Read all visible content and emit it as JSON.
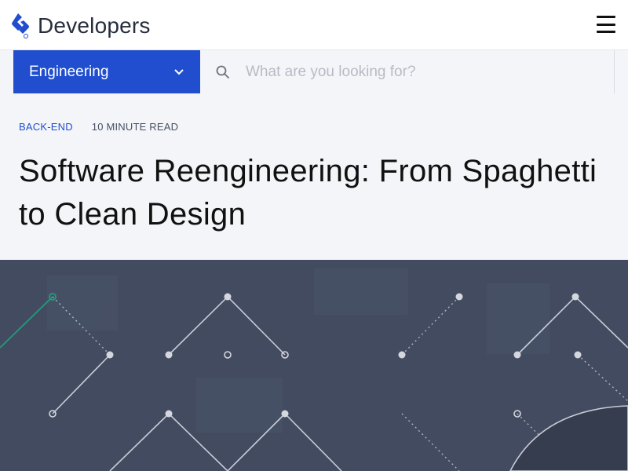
{
  "header": {
    "brand": "Developers",
    "menu_icon": "hamburger-menu-icon"
  },
  "search": {
    "category": "Engineering",
    "placeholder": "What are you looking for?",
    "value": ""
  },
  "article": {
    "category": "BACK-END",
    "read_time": "10 MINUTE READ",
    "title": "Software Reengineering: From Spaghetti to Clean Design"
  },
  "colors": {
    "brand_blue": "#204ecf",
    "header_bg": "#ffffff",
    "panel_bg": "#f4f5f8",
    "hero_bg": "#434b60",
    "accent_green": "#1e9e7a"
  }
}
